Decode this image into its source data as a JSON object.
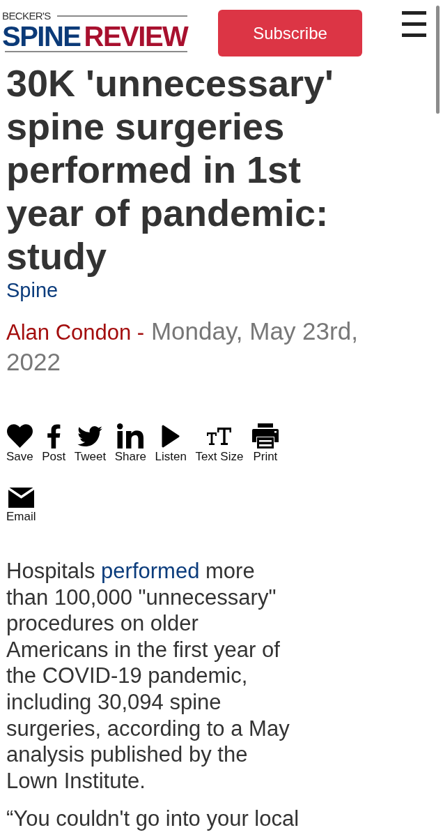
{
  "header": {
    "logo": {
      "top": "BECKER'S",
      "first": "SPINE",
      "second": "REVIEW"
    },
    "subscribe_button": "Subscribe"
  },
  "article": {
    "title": "30K 'unnecessary' spine surgeries performed in 1st year of pandemic: study",
    "category": "Spine",
    "author": "Alan Condon",
    "separator": "-",
    "date": "Monday, May 23rd, 2022"
  },
  "share_rows": [
    [
      {
        "kind": "heart",
        "label": "Save"
      },
      {
        "kind": "f",
        "label": "Post"
      },
      {
        "kind": "bird",
        "label": "Tweet"
      },
      {
        "kind": "in",
        "label": "Share"
      },
      {
        "kind": "play",
        "label": "Listen"
      },
      {
        "kind": "text_size",
        "label": "Text Size"
      },
      {
        "kind": "printer",
        "label": "Print"
      }
    ],
    [
      {
        "kind": "envelope",
        "label": "Email"
      }
    ]
  ],
  "body": [
    [
      {
        "kind": "text",
        "text": "Hospitals "
      },
      {
        "kind": "link",
        "text": "performed"
      },
      {
        "kind": "text",
        "text": " more than 100,000 \"unnecessary\" procedures on older Americans in the first year of the COVID-19 pandemic, including 30,094 spine surgeries, according to a May analysis published by the Lown Institute."
      }
    ],
    [
      {
        "kind": "text",
        "text": "“You couldn't go into your local"
      }
    ]
  ]
}
